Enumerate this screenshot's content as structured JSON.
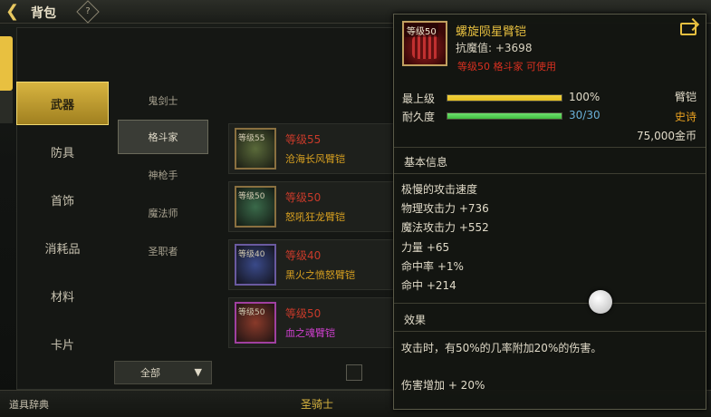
{
  "header": {
    "title": "背包",
    "back_icon": "back-arrow-icon",
    "help_icon": "diamond-help-icon"
  },
  "categories": [
    {
      "label": "武器",
      "active": true
    },
    {
      "label": "防具",
      "active": false
    },
    {
      "label": "首饰",
      "active": false
    },
    {
      "label": "消耗品",
      "active": false
    },
    {
      "label": "材料",
      "active": false
    },
    {
      "label": "卡片",
      "active": false
    }
  ],
  "subcategories": [
    {
      "label": "鬼剑士",
      "active": false
    },
    {
      "label": "格斗家",
      "active": true
    },
    {
      "label": "神枪手",
      "active": false
    },
    {
      "label": "魔法师",
      "active": false
    },
    {
      "label": "圣职者",
      "active": false
    }
  ],
  "items": [
    {
      "thumb_level": "等级55",
      "level": "等级55",
      "name": "沧海长风臂铠"
    },
    {
      "thumb_level": "等级50",
      "level": "等级50",
      "name": "怒吼狂龙臂铠"
    },
    {
      "thumb_level": "等级40",
      "level": "等级40",
      "name": "黑火之愤怒臂铠"
    },
    {
      "thumb_level": "等级50",
      "level": "等级50",
      "name": "血之魂臂铠"
    }
  ],
  "filter": {
    "label": "全部"
  },
  "bottom": {
    "left": "道具辞典",
    "middle": "圣骑士"
  },
  "tooltip": {
    "badge": "等级50",
    "name": "螺旋陨星臂铠",
    "resist": "抗魔值: +3698",
    "requirement": "等级50 格斗家 可使用",
    "quality_label": "最上级",
    "quality_value": "100%",
    "quality_fraction": 1.0,
    "durability_label": "耐久度",
    "durability_value": "30/30",
    "durability_fraction": 1.0,
    "slot": "臂铠",
    "rarity": "史诗",
    "price": "75,000金币",
    "section_basic": "基本信息",
    "stats": [
      "极慢的攻击速度",
      "物理攻击力 +736",
      "魔法攻击力 +552",
      "力量 +65",
      "命中率 +1%",
      "命中 +214"
    ],
    "section_effect": "效果",
    "effect_text": "攻击时，有50%的几率附加20%的伤害。",
    "damage_bonus": "伤害增加 + 20%",
    "colors": {
      "quality_bar": "#e8c020",
      "durability_bar": "#40c040",
      "name": "#e8c040",
      "requirement": "#d83020",
      "rarity": "#e8a020"
    }
  }
}
